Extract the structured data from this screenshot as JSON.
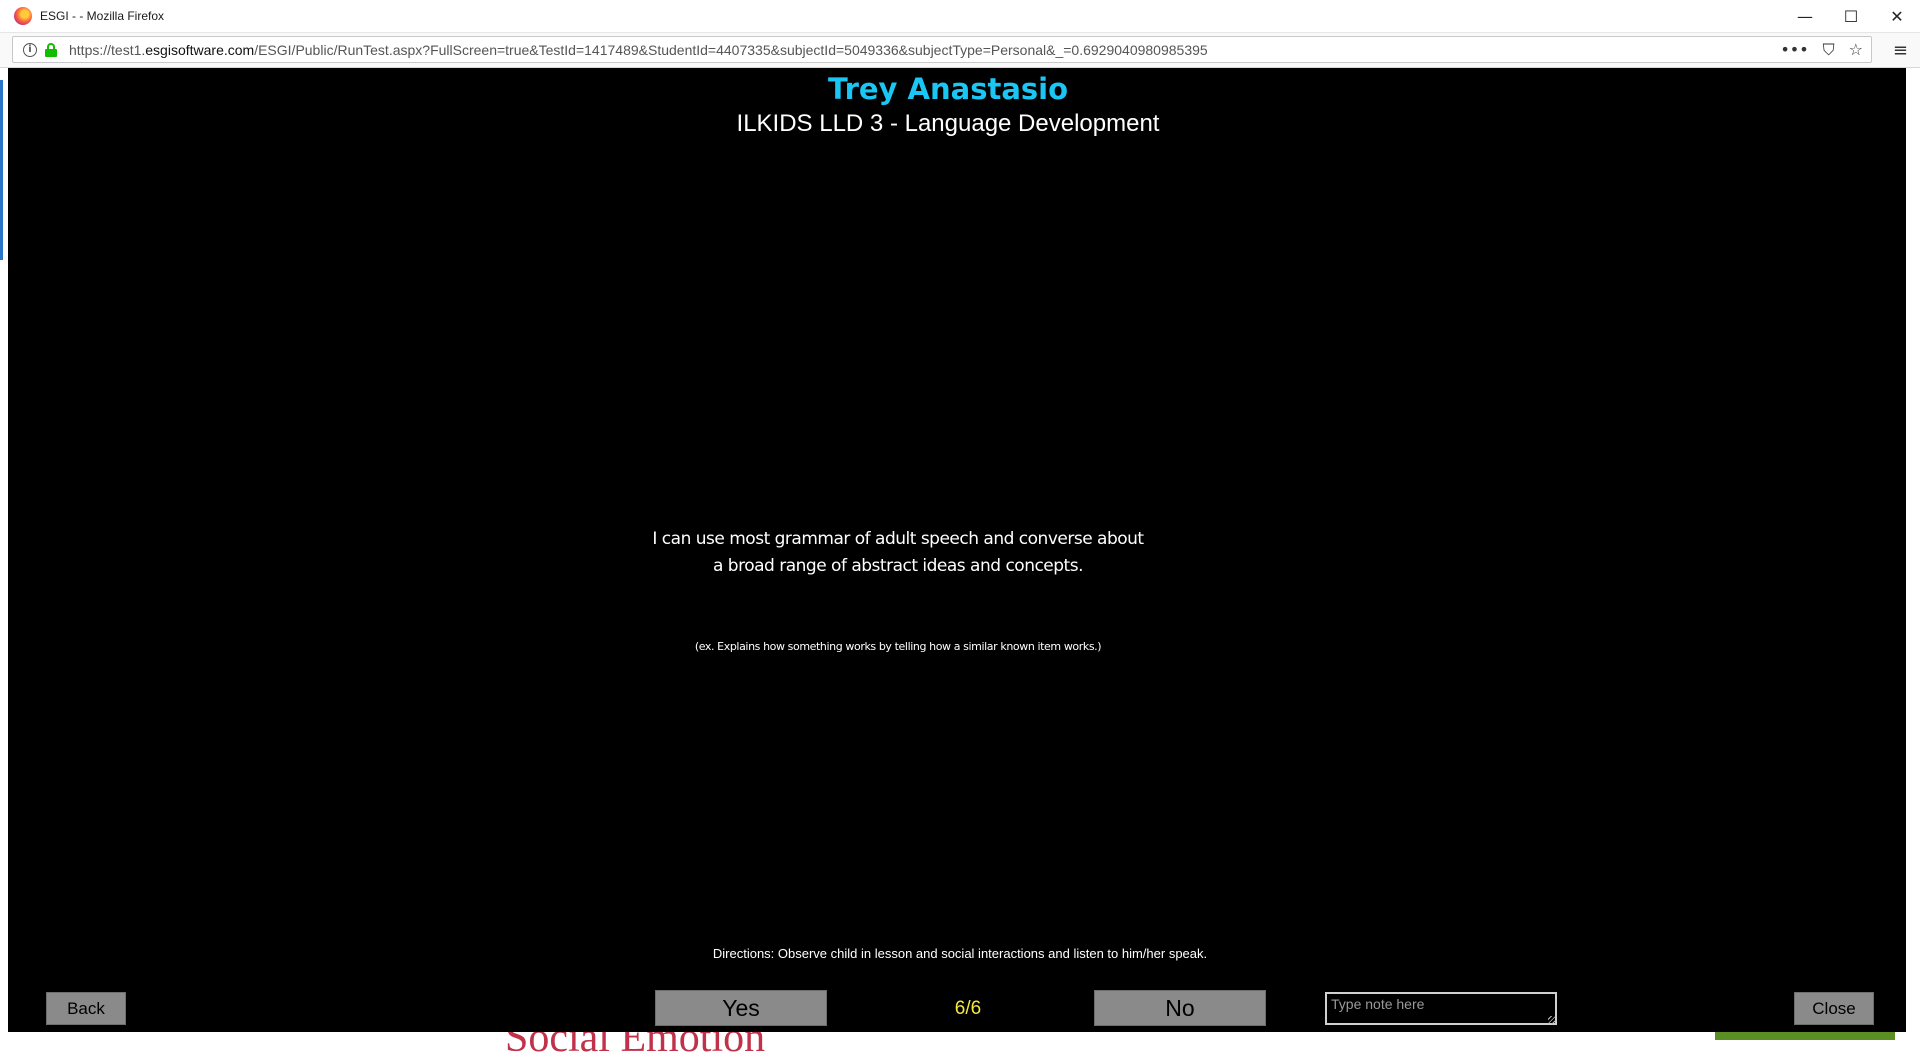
{
  "window": {
    "title": "ESGI - - Mozilla Firefox",
    "controls": {
      "minimize": "—",
      "maximize": "☐",
      "close": "✕"
    }
  },
  "browser": {
    "url_prefix": "https://test1.",
    "url_host": "esgisoftware.com",
    "url_path": "/ESGI/Public/RunTest.aspx?FullScreen=true&TestId=1417489&StudentId=4407335&subjectId=5049336&subjectType=Personal&_=0.6929040980985395",
    "icons": {
      "more": "•••",
      "pocket": "⛉",
      "bookmark": "☆",
      "menu": "≡",
      "info": "i"
    }
  },
  "background_page": {
    "partial_text": "Social Emotion"
  },
  "test": {
    "student_name": "Trey Anastasio",
    "test_name": "ILKIDS LLD 3 - Language Development",
    "question_line1": "I can use most grammar of adult speech and converse about",
    "question_line2": "a broad range of abstract ideas and concepts.",
    "example": "(ex. Explains how something works by telling how a similar known item works.)",
    "directions": "Directions: Observe child in lesson and social interactions and listen to him/her speak.",
    "counter": "6/6"
  },
  "controls": {
    "back_label": "Back",
    "yes_label": "Yes",
    "no_label": "No",
    "close_label": "Close",
    "note_placeholder": "Type note here"
  }
}
